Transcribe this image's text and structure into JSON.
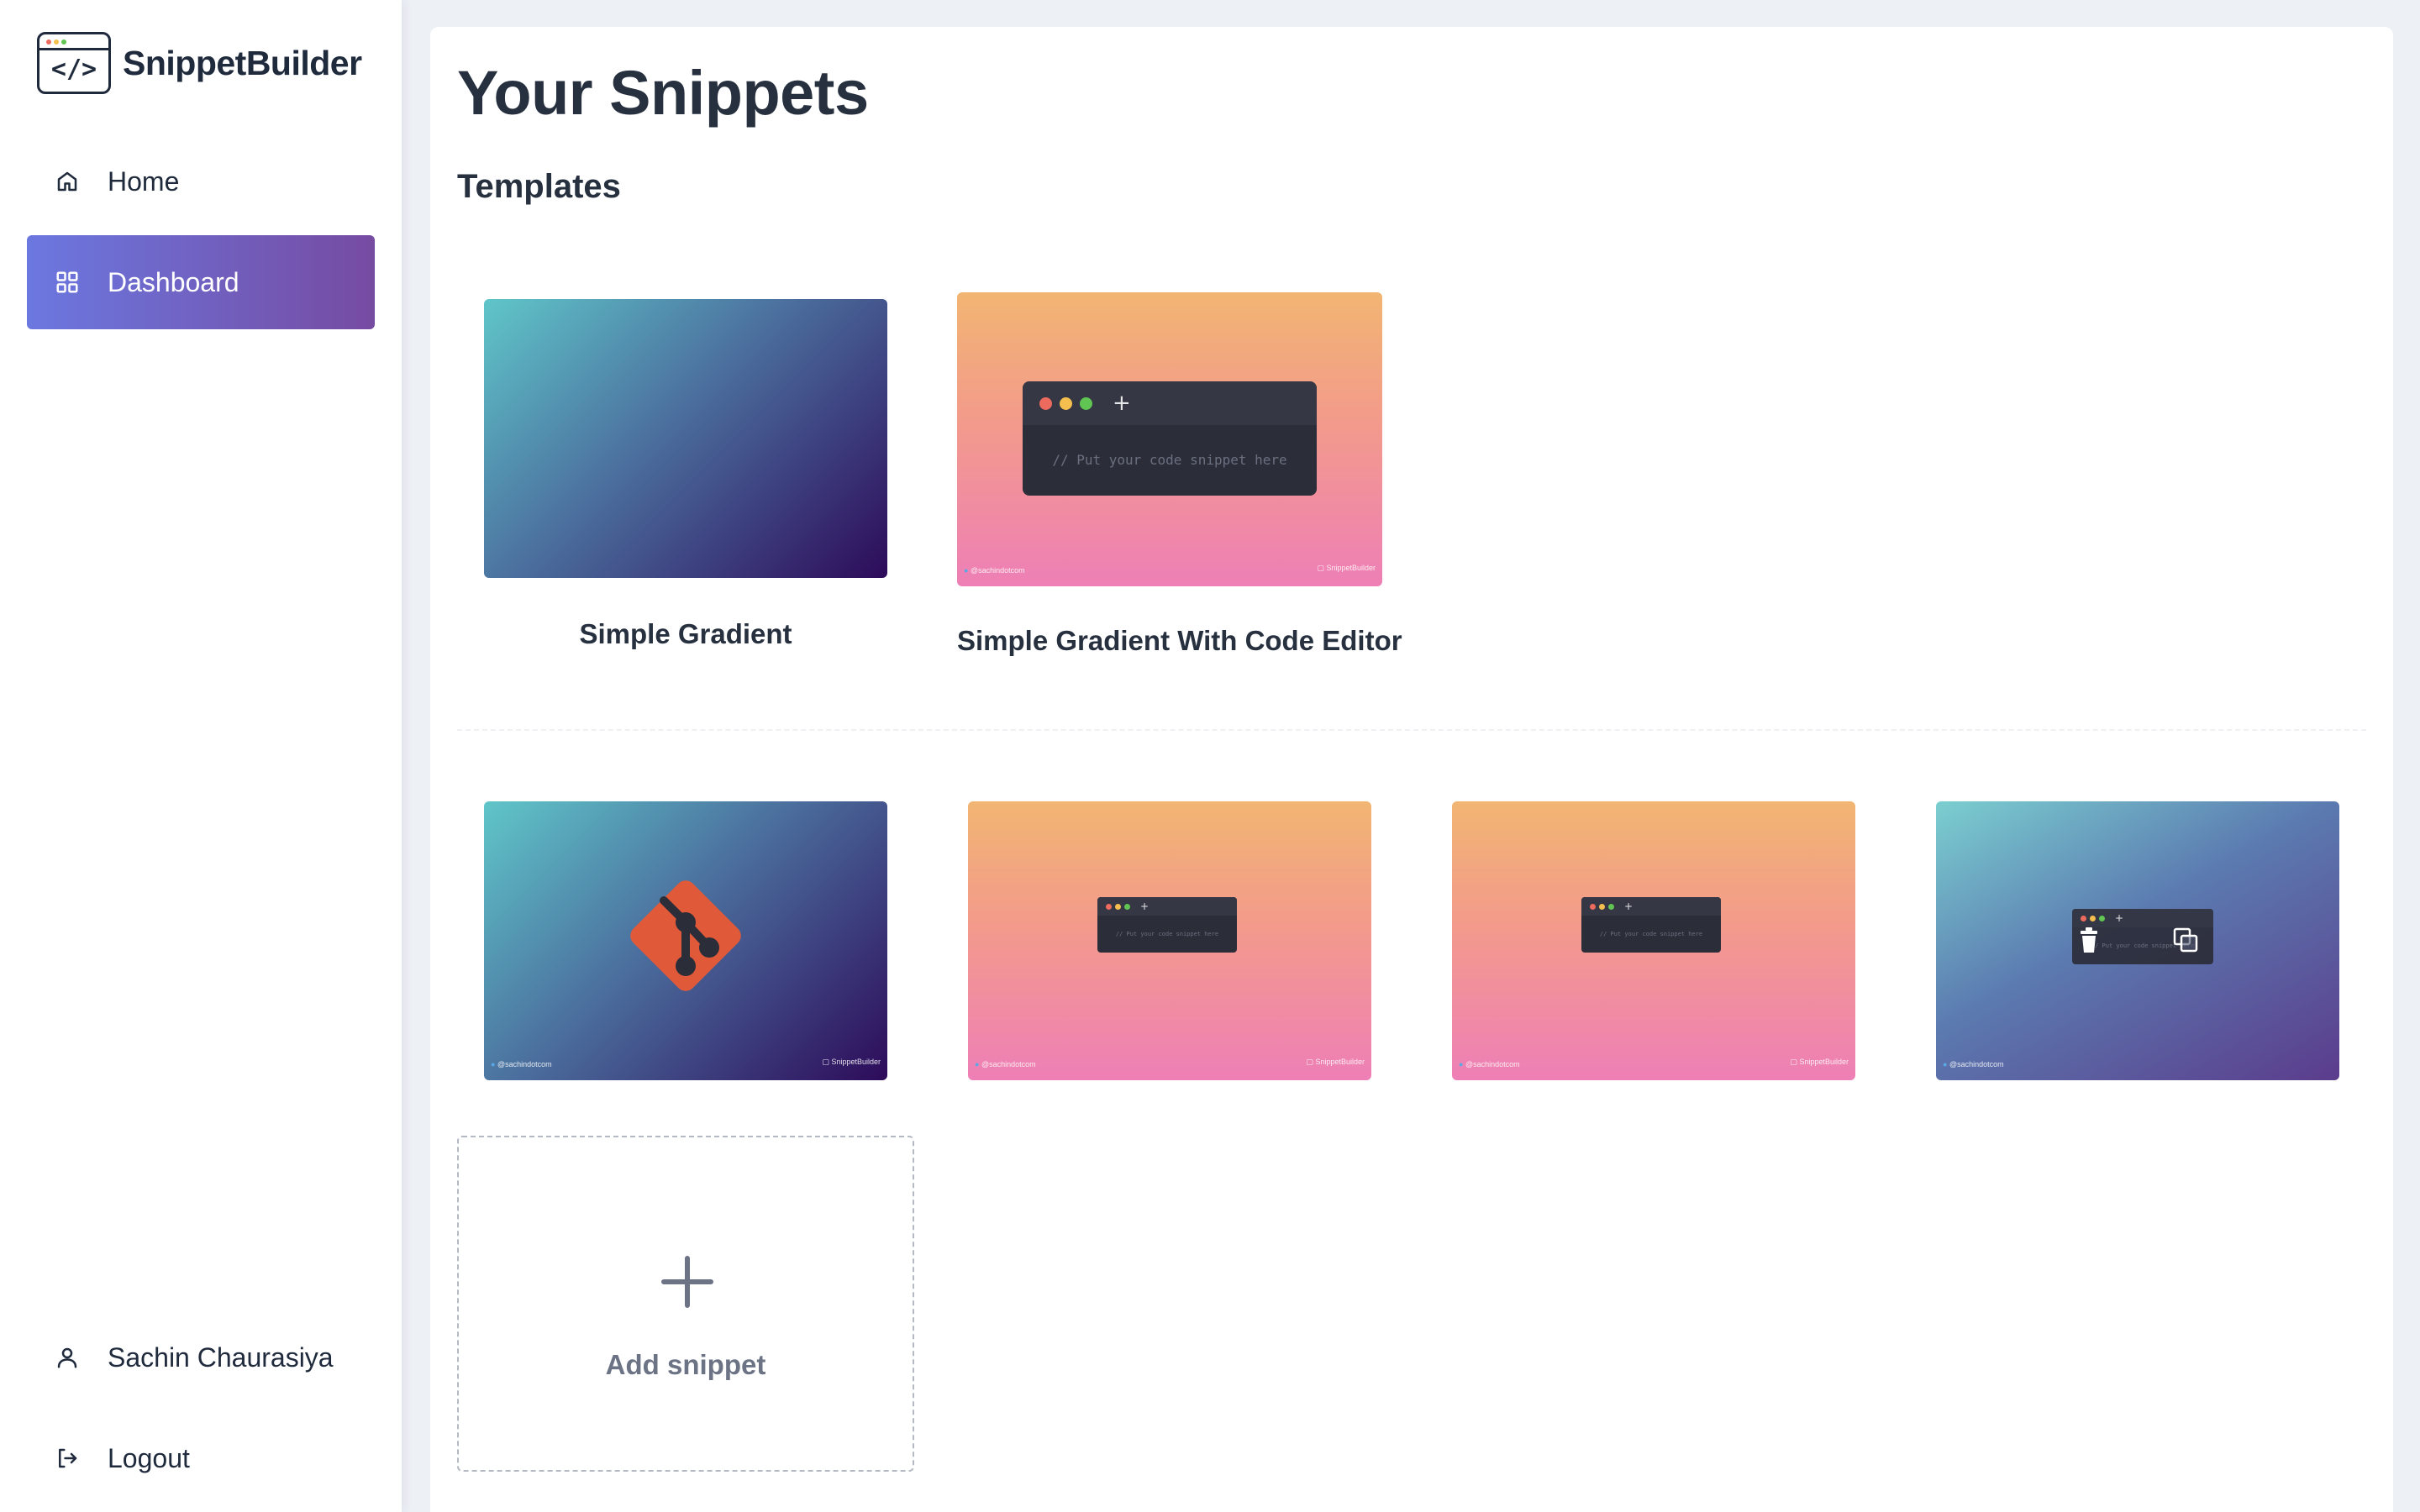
{
  "app": {
    "name": "SnippetBuilder",
    "logo_glyph": "</>"
  },
  "sidebar": {
    "nav": [
      {
        "label": "Home",
        "icon": "home-icon",
        "active": false
      },
      {
        "label": "Dashboard",
        "icon": "grid-icon",
        "active": true
      }
    ],
    "user": {
      "label": "Sachin Chaurasiya",
      "icon": "user-icon"
    },
    "logout": {
      "label": "Logout",
      "icon": "logout-icon"
    }
  },
  "main": {
    "title": "Your Snippets",
    "templates_heading": "Templates",
    "templates": [
      {
        "label": "Simple Gradient"
      },
      {
        "label": "Simple Gradient With Code Editor"
      }
    ],
    "editor_placeholder": "// Put your code snippet here",
    "editor_plus": "+",
    "footer_handle": "@sachindotcom",
    "footer_brand": "SnippetBuilder",
    "add_snippet_label": "Add snippet"
  },
  "colors": {
    "accent_gradient_start": "#6b78e0",
    "accent_gradient_end": "#764ba2",
    "text_dark": "#1f2a3c",
    "dot_red": "#ec6a5e",
    "dot_yellow": "#f4bf4f",
    "dot_green": "#61c554",
    "git_orange": "#e05a3a"
  }
}
